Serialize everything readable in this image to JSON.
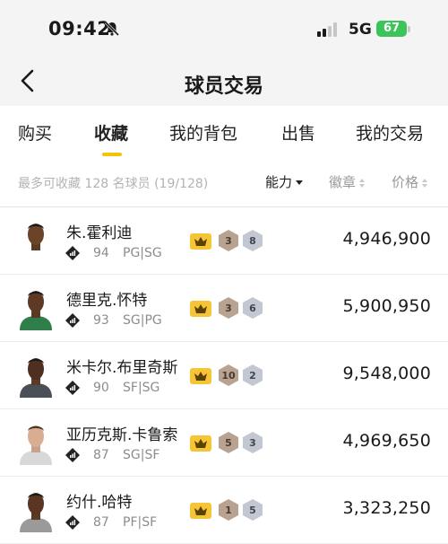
{
  "status_bar": {
    "time": "09:42",
    "network": "5G",
    "battery": "67"
  },
  "nav": {
    "title": "球员交易"
  },
  "tabs": [
    {
      "label": "购买"
    },
    {
      "label": "收藏"
    },
    {
      "label": "我的背包"
    },
    {
      "label": "出售"
    },
    {
      "label": "我的交易"
    }
  ],
  "active_tab": "收藏",
  "filter": {
    "capacity_text": "最多可收藏 128 名球员 (19/128)",
    "sort_ability": "能力",
    "sort_badge": "徽章",
    "sort_price": "价格"
  },
  "players": [
    {
      "name": "朱.霍利迪",
      "rating": "94",
      "positions": "PG|SG",
      "bronze_badges": "3",
      "silver_badges": "8",
      "price": "4,946,900",
      "jersey_color": "#ffffff"
    },
    {
      "name": "德里克.怀特",
      "rating": "93",
      "positions": "SG|PG",
      "bronze_badges": "3",
      "silver_badges": "6",
      "price": "5,900,950",
      "jersey_color": "#2e7d4a"
    },
    {
      "name": "米卡尔.布里奇斯",
      "rating": "90",
      "positions": "SF|SG",
      "bronze_badges": "10",
      "silver_badges": "2",
      "price": "9,548,000",
      "jersey_color": "#4a4f57"
    },
    {
      "name": "亚历克斯.卡鲁索",
      "rating": "87",
      "positions": "SG|SF",
      "bronze_badges": "5",
      "silver_badges": "3",
      "price": "4,969,650",
      "jersey_color": "#d8d8d8"
    },
    {
      "name": "约什.哈特",
      "rating": "87",
      "positions": "PF|SF",
      "bronze_badges": "1",
      "silver_badges": "5",
      "price": "3,323,250",
      "jersey_color": "#9a9a9a"
    }
  ],
  "colors": {
    "accent": "#f5c400",
    "bronze": "#b8a392",
    "silver": "#c2c7d1"
  }
}
